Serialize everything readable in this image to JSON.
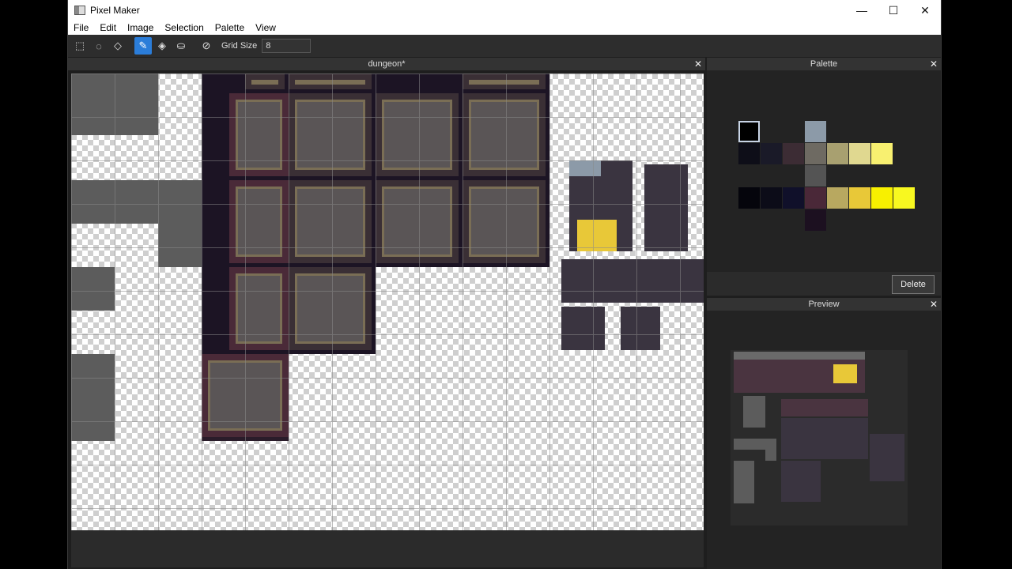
{
  "window": {
    "title": "Pixel Maker",
    "controls": [
      "—",
      "☐",
      "✕"
    ]
  },
  "menu": [
    "File",
    "Edit",
    "Image",
    "Selection",
    "Palette",
    "View"
  ],
  "toolbar": {
    "tools": [
      {
        "icon": "rect-select-icon",
        "glyph": "⬚"
      },
      {
        "icon": "ellipse-select-icon",
        "glyph": "◌"
      },
      {
        "icon": "lasso-select-icon",
        "glyph": "◇"
      },
      {
        "icon": "pencil-icon",
        "glyph": "✎"
      },
      {
        "icon": "eraser-icon",
        "glyph": "◈"
      },
      {
        "icon": "fill-bucket-icon",
        "glyph": "⛀"
      },
      {
        "icon": "eyedropper-icon",
        "glyph": "⊘"
      }
    ],
    "active_tool": "pencil-icon",
    "grid_size_label": "Grid Size",
    "grid_size_value": "8"
  },
  "document": {
    "tab_title": "dungeon*",
    "close": "✕"
  },
  "palette": {
    "title": "Palette",
    "close": "✕",
    "delete_label": "Delete",
    "colors": [
      "#000000",
      "#8c9aa8",
      "#0e0e18",
      "#1a1a28",
      "#3c2c34",
      "#6e6a62",
      "#a8a070",
      "#e0d890",
      "#f8f070",
      "#545454",
      "#05050c",
      "#0c0c18",
      "#10102a",
      "#4a2838",
      "#b8a860",
      "#e8c838",
      "#f8f000",
      "#f8f820",
      "#1c1020"
    ],
    "selected_color": "#000000"
  },
  "preview": {
    "title": "Preview",
    "close": "✕"
  }
}
